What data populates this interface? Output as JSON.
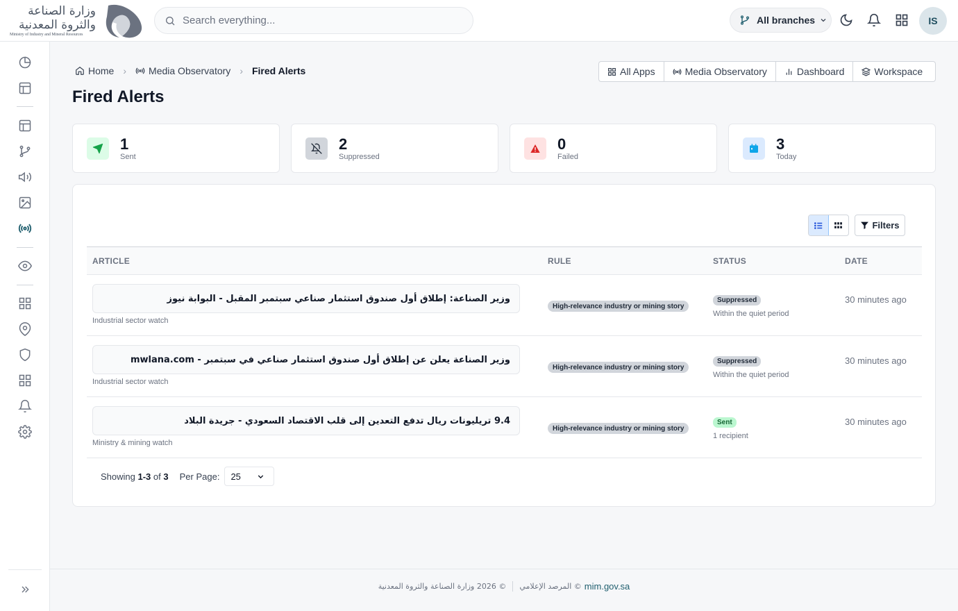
{
  "header": {
    "logo": {
      "line1": "وزارة الصناعة",
      "line2": "والثروة المعدنية",
      "line3": "Ministry of Industry and Mineral Resources"
    },
    "search_placeholder": "Search everything...",
    "branch_label": "All branches",
    "avatar_initials": "IS"
  },
  "breadcrumb": {
    "home": "Home",
    "section": "Media Observatory",
    "current": "Fired Alerts"
  },
  "page_title": "Fired Alerts",
  "app_nav": [
    {
      "label": "All Apps",
      "icon": "grid-icon"
    },
    {
      "label": "Media Observatory",
      "icon": "broadcast-icon"
    },
    {
      "label": "Dashboard",
      "icon": "bar-chart-icon"
    },
    {
      "label": "Workspace",
      "icon": "layers-icon"
    }
  ],
  "stats": [
    {
      "value": "1",
      "label": "Sent",
      "icon": "send-icon",
      "color": "#16a34a",
      "bg": "#dcfce7"
    },
    {
      "value": "2",
      "label": "Suppressed",
      "icon": "bell-off-icon",
      "color": "#1f2937",
      "bg": "#d1d5db"
    },
    {
      "value": "0",
      "label": "Failed",
      "icon": "warning-icon",
      "color": "#dc2626",
      "bg": "#fee2e2"
    },
    {
      "value": "3",
      "label": "Today",
      "icon": "calendar-icon",
      "color": "#0ea5e9",
      "bg": "#dbeafe"
    }
  ],
  "toolbar": {
    "filters_label": "Filters"
  },
  "table": {
    "columns": [
      "ARTICLE",
      "RULE",
      "STATUS",
      "DATE"
    ],
    "rows": [
      {
        "article": "وزير الصناعة: إطلاق أول صندوق استثمار صناعي سبتمبر المقبل - البوابة نيوز",
        "watch": "Industrial sector watch",
        "rule": "High-relevance industry or mining story",
        "status": "Suppressed",
        "status_note": "Within the quiet period",
        "date": "30 minutes ago"
      },
      {
        "article": "وزير الصناعة يعلن عن إطلاق أول صندوق استثمار صناعي في سبتمبر - mwlana.com",
        "watch": "Industrial sector watch",
        "rule": "High-relevance industry or mining story",
        "status": "Suppressed",
        "status_note": "Within the quiet period",
        "date": "30 minutes ago"
      },
      {
        "article": "9.4 تريليونات ريال تدفع التعدين إلى قلب الاقتصاد السعودي - جريدة البلاد",
        "watch": "Ministry & mining watch",
        "rule": "High-relevance industry or mining story",
        "status": "Sent",
        "status_note": "1 recipient",
        "date": "30 minutes ago"
      }
    ]
  },
  "pagination": {
    "prefix": "Showing",
    "range": "1-3",
    "of_word": "of",
    "total": "3",
    "per_page_label": "Per Page:",
    "per_page_value": "25"
  },
  "footer": {
    "copyright": "© 2026 وزارة الصناعة والثروة المعدنية",
    "observatory": "© المرصد الإعلامي",
    "link": "mim.gov.sa"
  },
  "colors": {
    "accent": "#1f5e6e",
    "active_sidebar": "#1f5e6e"
  }
}
